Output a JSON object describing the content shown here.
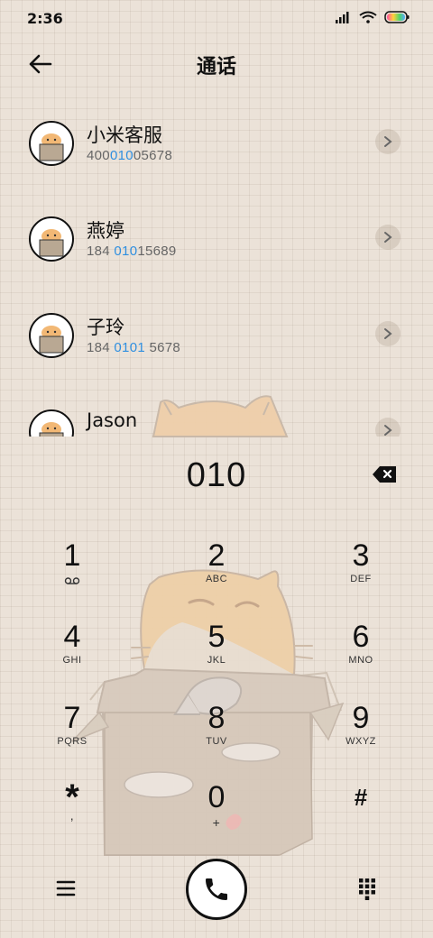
{
  "status_bar": {
    "time": "2:36"
  },
  "header": {
    "title": "通话",
    "back_icon": "back-arrow-icon"
  },
  "contacts": [
    {
      "name": "小米客服",
      "num_pre": "400",
      "num_hl": "010",
      "num_post": "05678"
    },
    {
      "name": "燕婷",
      "num_pre": "184 ",
      "num_hl": "010",
      "num_post": "15689"
    },
    {
      "name": "子玲",
      "num_pre": "184 ",
      "num_hl": "0101",
      "num_post": " 5678"
    },
    {
      "name": "Jason",
      "num_pre": "",
      "num_hl": "",
      "num_post": ""
    }
  ],
  "dialer": {
    "input": "010"
  },
  "keys": [
    {
      "num": "1",
      "sub": ""
    },
    {
      "num": "2",
      "sub": "ABC"
    },
    {
      "num": "3",
      "sub": "DEF"
    },
    {
      "num": "4",
      "sub": "GHI"
    },
    {
      "num": "5",
      "sub": "JKL"
    },
    {
      "num": "6",
      "sub": "MNO"
    },
    {
      "num": "7",
      "sub": "PQRS"
    },
    {
      "num": "8",
      "sub": "TUV"
    },
    {
      "num": "9",
      "sub": "WXYZ"
    },
    {
      "num": "*",
      "sub": ","
    },
    {
      "num": "0",
      "sub": "+"
    },
    {
      "num": "#",
      "sub": ""
    }
  ],
  "colors": {
    "background": "#ebe2d8",
    "highlight": "#2f8fe0"
  }
}
